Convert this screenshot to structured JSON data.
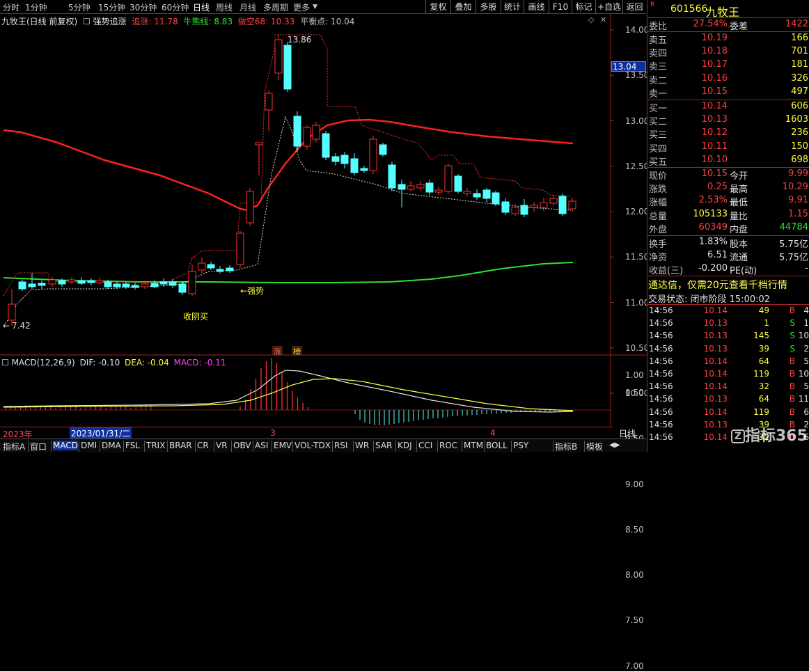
{
  "toolbar": {
    "periods": [
      "分时",
      "1分钟",
      "5分钟",
      "15分钟",
      "30分钟",
      "60分钟",
      "日线",
      "周线",
      "月线",
      "多周期",
      "更多"
    ],
    "active": "日线",
    "buttons": [
      "复权",
      "叠加",
      "多股",
      "统计",
      "画线",
      "F10",
      "标记",
      "+自选",
      "返回"
    ]
  },
  "legend": {
    "title": "九牧王(日线 前复权)",
    "indicator": "强势追涨",
    "items": [
      {
        "label": "追涨: 11.78",
        "color": "#ff4040"
      },
      {
        "label": "牛熊线: 8.83",
        "color": "#30e030"
      },
      {
        "label": "做空68: 10.33",
        "color": "#ff4040"
      },
      {
        "label": "平衡点: 10.04",
        "color": "#c0c0c0"
      }
    ]
  },
  "annotations": {
    "high": "13.86",
    "low": "7.42",
    "strong": "←强势",
    "buy": "收阴买",
    "badge1": "涨",
    "badge2": "榜"
  },
  "price_axis": {
    "ticks": [
      "14.00",
      "13.50",
      "13.00",
      "12.50",
      "12.00",
      "11.50",
      "11.00",
      "10.50",
      "10.00",
      "9.50",
      "9.00",
      "8.50",
      "8.00",
      "7.50",
      "7.00"
    ],
    "current": "13.04"
  },
  "macd": {
    "legend": "MACD(12,26,9)",
    "dif": "DIF: -0.10",
    "dea": "DEA: -0.04",
    "macd": "MACD: -0.11",
    "ticks": [
      "1.00",
      "0.50"
    ]
  },
  "date_axis": {
    "year": "2023年",
    "cursor": "2023/01/31/二",
    "m3": "3",
    "m4": "4",
    "period": "日线"
  },
  "quote": {
    "code": "601566",
    "name": "九牧王",
    "webi_label": "委比",
    "webi": "27.54%",
    "weicha_label": "委差",
    "weicha": "1422",
    "asks": [
      {
        "label": "卖五",
        "price": "10.19",
        "vol": "166"
      },
      {
        "label": "卖四",
        "price": "10.18",
        "vol": "701"
      },
      {
        "label": "卖三",
        "price": "10.17",
        "vol": "181"
      },
      {
        "label": "卖二",
        "price": "10.16",
        "vol": "326"
      },
      {
        "label": "卖一",
        "price": "10.15",
        "vol": "497"
      }
    ],
    "bids": [
      {
        "label": "买一",
        "price": "10.14",
        "vol": "606"
      },
      {
        "label": "买二",
        "price": "10.13",
        "vol": "1603"
      },
      {
        "label": "买三",
        "price": "10.12",
        "vol": "236"
      },
      {
        "label": "买四",
        "price": "10.11",
        "vol": "150"
      },
      {
        "label": "买五",
        "price": "10.10",
        "vol": "698"
      }
    ],
    "stats": [
      {
        "l1": "现价",
        "v1": "10.15",
        "c1": "red",
        "l2": "今开",
        "v2": "9.99",
        "c2": "red"
      },
      {
        "l1": "涨跌",
        "v1": "0.25",
        "c1": "red",
        "l2": "最高",
        "v2": "10.29",
        "c2": "red"
      },
      {
        "l1": "涨幅",
        "v1": "2.53%",
        "c1": "red",
        "l2": "最低",
        "v2": "9.91",
        "c2": "red"
      },
      {
        "l1": "总量",
        "v1": "105133",
        "c1": "yel",
        "l2": "量比",
        "v2": "1.15",
        "c2": "red"
      },
      {
        "l1": "外盘",
        "v1": "60349",
        "c1": "red",
        "l2": "内盘",
        "v2": "44784",
        "c2": "grn"
      }
    ],
    "stats2": [
      {
        "l1": "换手",
        "v1": "1.83%",
        "l2": "股本",
        "v2": "5.75亿"
      },
      {
        "l1": "净资",
        "v1": "6.51",
        "l2": "流通",
        "v2": "5.75亿"
      },
      {
        "l1": "收益(三)",
        "v1": "-0.200",
        "l2": "PE(动)",
        "v2": "-"
      }
    ],
    "ad": "通达信，仅需20元查看千档行情",
    "status": "交易状态: 闭市阶段 15:00:02",
    "ticks": [
      {
        "t": "14:56",
        "p": "10.14",
        "v": "49",
        "d": "B",
        "n": "4"
      },
      {
        "t": "14:56",
        "p": "10.13",
        "v": "1",
        "d": "S",
        "n": "1"
      },
      {
        "t": "14:56",
        "p": "10.13",
        "v": "145",
        "d": "S",
        "n": "10"
      },
      {
        "t": "14:56",
        "p": "10.13",
        "v": "39",
        "d": "S",
        "n": "2"
      },
      {
        "t": "14:56",
        "p": "10.14",
        "v": "64",
        "d": "B",
        "n": "5"
      },
      {
        "t": "14:56",
        "p": "10.14",
        "v": "119",
        "d": "B",
        "n": "10"
      },
      {
        "t": "14:56",
        "p": "10.14",
        "v": "32",
        "d": "B",
        "n": "5"
      },
      {
        "t": "14:56",
        "p": "10.13",
        "v": "64",
        "d": "B",
        "n": "11"
      },
      {
        "t": "14:56",
        "p": "10.14",
        "v": "119",
        "d": "B",
        "n": "6"
      },
      {
        "t": "14:56",
        "p": "10.13",
        "v": "39",
        "d": "B",
        "n": "2"
      },
      {
        "t": "14:56",
        "p": "10.14",
        "v": "32",
        "d": "B",
        "n": "6"
      }
    ]
  },
  "bottom": [
    "指标A",
    "窗口",
    "MACD",
    "DMI",
    "DMA",
    "FSL",
    "TRIX",
    "BRAR",
    "CR",
    "VR",
    "OBV",
    "ASI",
    "EMV",
    "VOL-TDX",
    "RSI",
    "WR",
    "SAR",
    "KDJ",
    "CCI",
    "ROC",
    "MTM",
    "BOLL",
    "PSY",
    "指标B",
    "模板"
  ],
  "bottom_active": "MACD",
  "watermark": "指标365"
}
